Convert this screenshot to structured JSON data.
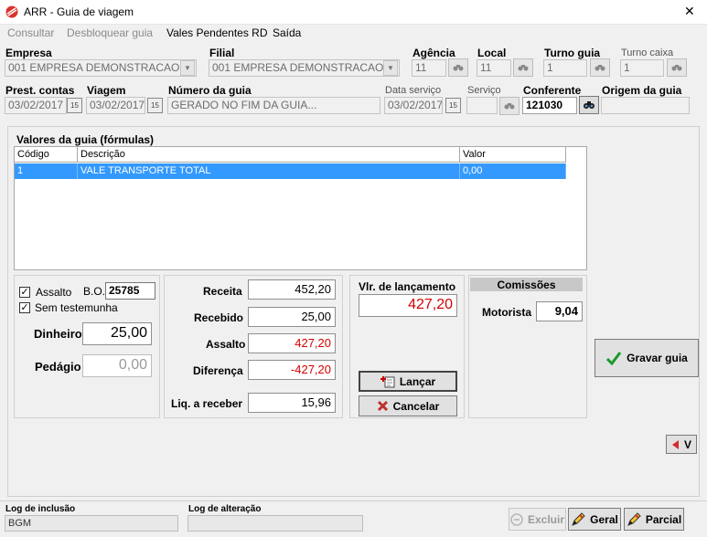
{
  "window": {
    "title": "ARR - Guia de viagem",
    "close_glyph": "✕"
  },
  "menu": [
    {
      "label": "Consultar",
      "enabled": false
    },
    {
      "label": "Desbloquear guia",
      "enabled": false
    },
    {
      "label": "Vales Pendentes RD",
      "enabled": true
    },
    {
      "label": "Saída",
      "enabled": true
    }
  ],
  "header": {
    "empresa": {
      "label": "Empresa",
      "value": "001 EMPRESA DEMONSTRACAO."
    },
    "filial": {
      "label": "Filial",
      "value": "001 EMPRESA DEMONSTRACAO."
    },
    "agencia": {
      "label": "Agência",
      "value": "11"
    },
    "local": {
      "label": "Local",
      "value": "11"
    },
    "turno_guia": {
      "label": "Turno guia",
      "value": "1"
    },
    "turno_caixa": {
      "label": "Turno caixa",
      "value": "1"
    },
    "prest_contas": {
      "label": "Prest. contas",
      "value": "03/02/2017"
    },
    "viagem": {
      "label": "Viagem",
      "value": "03/02/2017"
    },
    "numero_guia": {
      "label": "Número da guia",
      "value": "GERADO NO FIM DA GUIA..."
    },
    "data_servico": {
      "label": "Data serviço",
      "value": "03/02/2017"
    },
    "servico": {
      "label": "Serviço",
      "value": ""
    },
    "conferente": {
      "label": "Conferente",
      "value": "121030"
    },
    "origem_guia": {
      "label": "Origem da guia",
      "value": ""
    },
    "calendar_glyph": "15"
  },
  "valores": {
    "title": "Valores da guia (fórmulas)",
    "columns": [
      "Código",
      "Descrição",
      "Valor"
    ],
    "rows": [
      {
        "codigo": "1",
        "descricao": "VALE TRANSPORTE TOTAL",
        "valor": "0,00"
      }
    ]
  },
  "left_panel": {
    "assalto_label": "Assalto",
    "assalto_checked": true,
    "bo_label": "B.O.",
    "bo_value": "25785",
    "sem_testemunha_label": "Sem testemunha",
    "sem_testemunha_checked": true,
    "dinheiro_label": "Dinheiro",
    "dinheiro_value": "25,00",
    "pedagio_label": "Pedágio",
    "pedagio_value": "0,00"
  },
  "totals": {
    "receita_label": "Receita",
    "receita_value": "452,20",
    "recebido_label": "Recebido",
    "recebido_value": "25,00",
    "assalto_label": "Assalto",
    "assalto_value": "427,20",
    "diferenca_label": "Diferença",
    "diferenca_value": "-427,20",
    "liq_label": "Liq. a receber",
    "liq_value": "15,96"
  },
  "lancamento": {
    "label": "Vlr. de lançamento",
    "value": "427,20",
    "lancar_label": "Lançar",
    "cancelar_label": "Cancelar"
  },
  "comissoes": {
    "title": "Comissões",
    "motorista_label": "Motorista",
    "motorista_value": "9,04"
  },
  "actions": {
    "gravar_label": "Gravar guia",
    "v_label": "V",
    "excluir_label": "Excluir",
    "geral_label": "Geral",
    "parcial_label": "Parcial"
  },
  "footer": {
    "log_inclusao_label": "Log de inclusão",
    "log_inclusao_value": "BGM",
    "log_alteracao_label": "Log de alteração",
    "log_alteracao_value": ""
  },
  "colors": {
    "selection": "#3399ff",
    "negative": "#d40000",
    "check_green": "#1a9a2a"
  }
}
